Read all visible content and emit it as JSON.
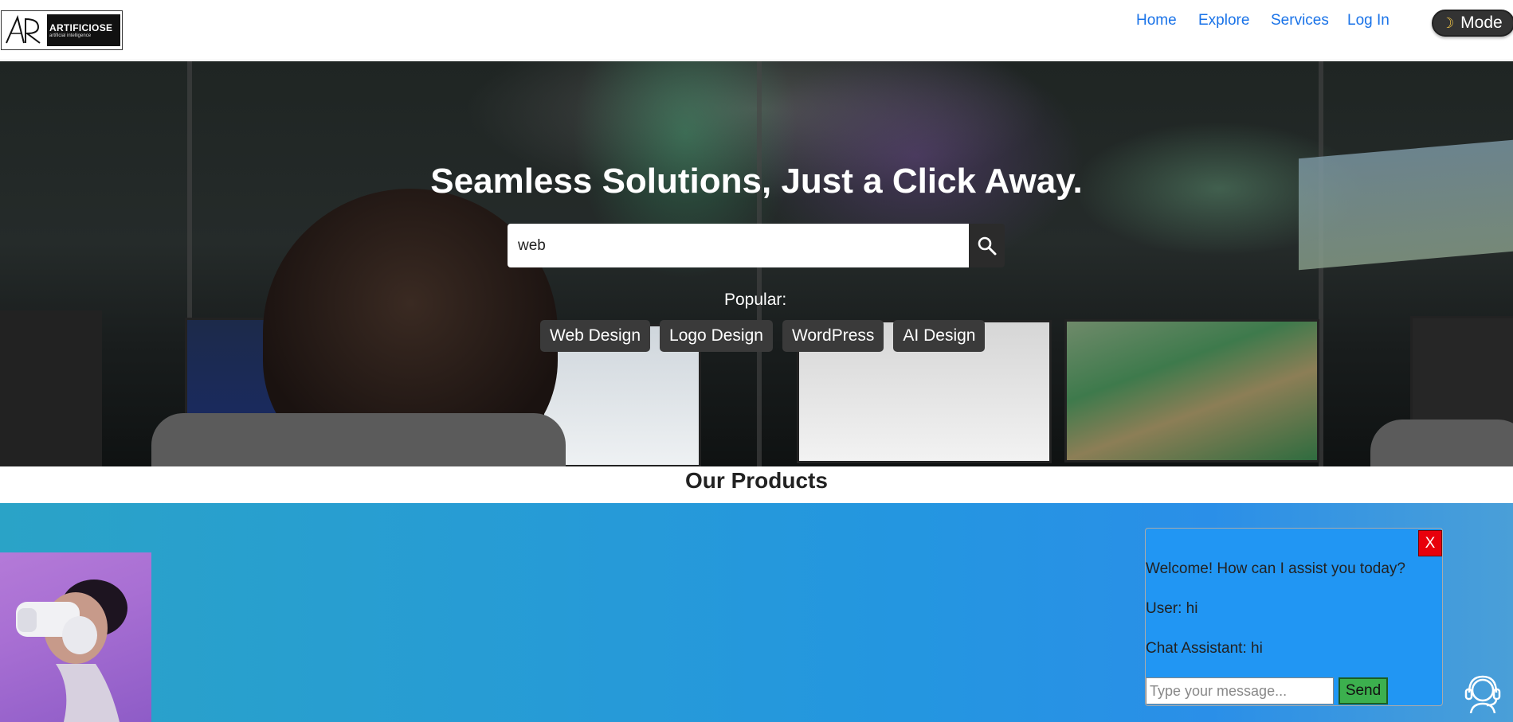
{
  "brand": {
    "logo_title": "ARTIFICIOSE",
    "logo_subtitle": "artificial intelligence"
  },
  "nav": {
    "items": [
      {
        "label": "Home"
      },
      {
        "label": "Explore"
      },
      {
        "label": "Services"
      },
      {
        "label": "Log In"
      }
    ],
    "mode_label": "Mode",
    "mode_icon": "moon-icon"
  },
  "hero": {
    "title": "Seamless Solutions, Just a Click Away.",
    "search_value": "web",
    "search_icon": "search-icon",
    "popular_label": "Popular:",
    "tags": [
      "Web Design",
      "Logo Design",
      "WordPress",
      "AI Design"
    ]
  },
  "products": {
    "title": "Our Products"
  },
  "chat": {
    "close_label": "X",
    "messages": [
      "Welcome! How can I assist you today?",
      "User: hi",
      "Chat Assistant: hi"
    ],
    "input_placeholder": "Type your message...",
    "send_label": "Send"
  },
  "colors": {
    "link": "#1a73e8",
    "chat_bg": "#2196f3",
    "close_bg": "#e8000b",
    "send_bg": "#3cb04e"
  }
}
